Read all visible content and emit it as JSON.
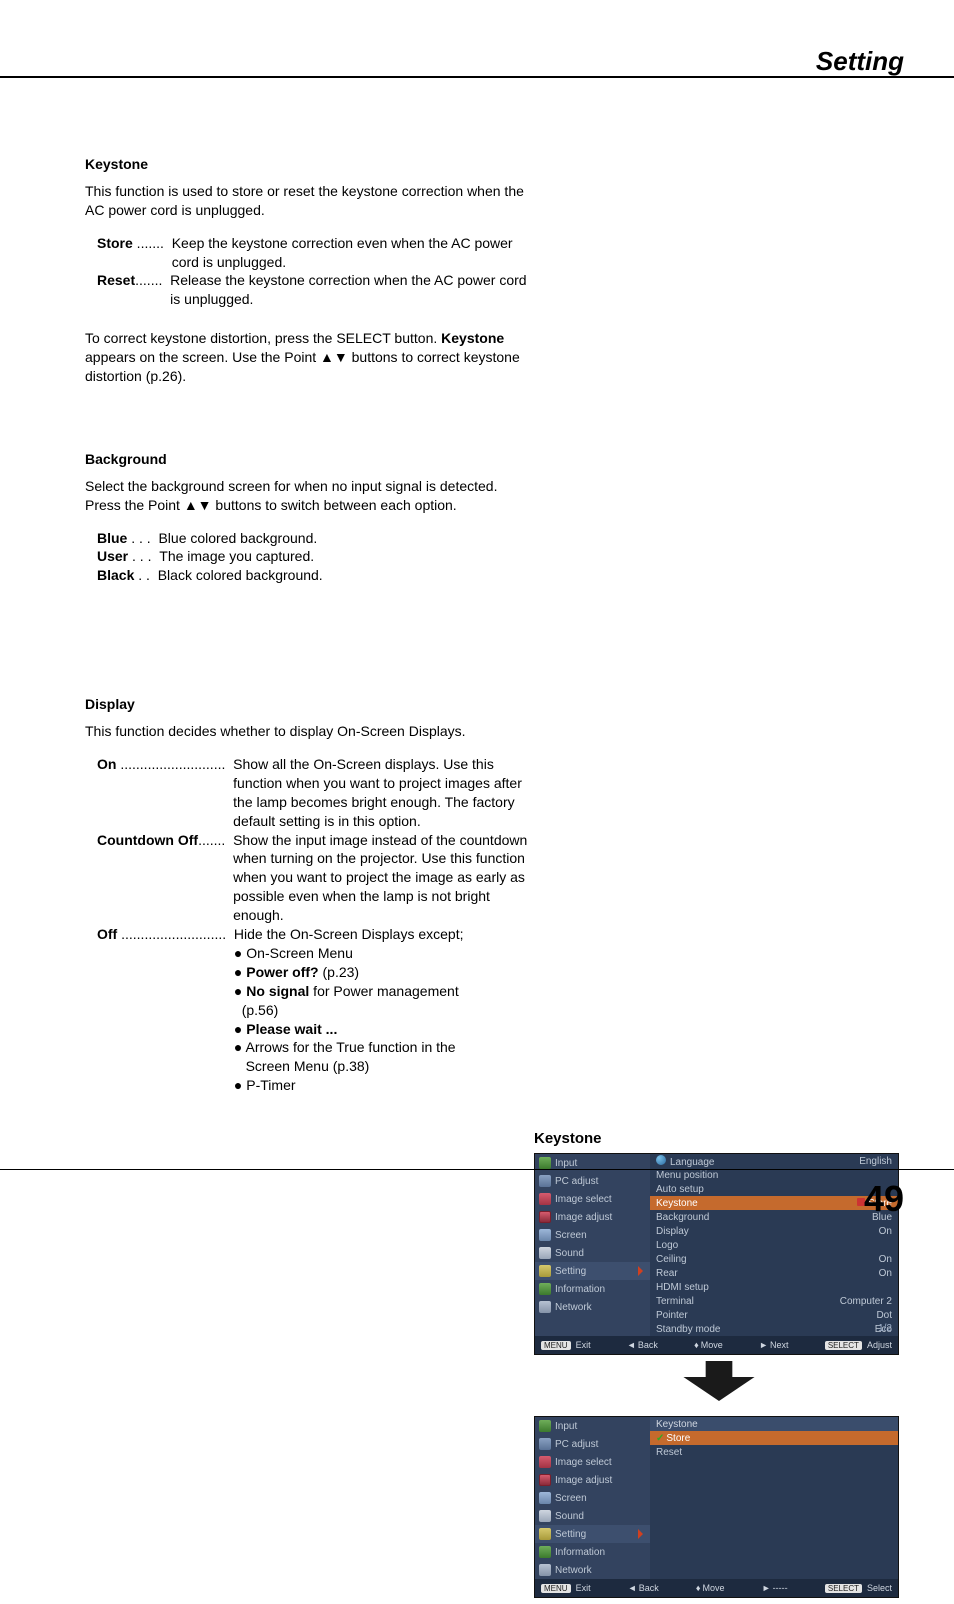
{
  "header": {
    "title": "Setting"
  },
  "page_number": "49",
  "sections": {
    "keystone": {
      "title": "Keystone",
      "intro": "This function is used to store or reset the keystone correction when the AC power cord is unplugged.",
      "items": [
        {
          "term": "Store",
          "dots": " .......  ",
          "desc": "Keep the keystone correction even when the AC power cord is unplugged."
        },
        {
          "term": "Reset",
          "dots": ".......  ",
          "desc": "Release the keystone correction when the AC power cord is unplugged."
        }
      ],
      "note_pre": "To correct keystone distortion, press the SELECT button. ",
      "note_bold": "Keystone",
      "note_mid": " appears on the screen. Use the Point ▲▼ buttons to correct keystone distortion (p.26)."
    },
    "background": {
      "title": "Background",
      "intro": "Select the background screen for when no input signal is detected. Press the Point ▲▼ buttons to switch between each option.",
      "items": [
        {
          "term": "Blue",
          "dots": " . . .  ",
          "desc": "Blue colored background."
        },
        {
          "term": "User",
          "dots": " . . .  ",
          "desc": "The image you captured."
        },
        {
          "term": "Black",
          "dots": " . .  ",
          "desc": "Black colored background."
        }
      ]
    },
    "display": {
      "title": "Display",
      "intro": "This function decides whether to display On-Screen Displays.",
      "items": {
        "on": {
          "term": "On",
          "dots": " ...........................  ",
          "desc": "Show all the On-Screen displays. Use this function when you want to project images after the lamp becomes bright enough. The factory default setting is in this option."
        },
        "cd": {
          "term": "Countdown Off",
          "dots": ".......  ",
          "desc": "Show the input image instead of the countdown when turning on the projector. Use this function when you want to project the image as early as possible even when the lamp is not bright enough."
        },
        "off": {
          "term": "Off",
          "dots": " ...........................  ",
          "lead": "Hide the On-Screen Displays except;",
          "bullets": {
            "b1": "● On-Screen Menu",
            "b2a": "● ",
            "b2b": "Power off?",
            "b2c": " (p.23)",
            "b3a": "● ",
            "b3b": "No signal",
            "b3c": " for Power management",
            "b3d": "  (p.56)",
            "b4a": "● ",
            "b4b": "Please wait ...",
            "b5": "● Arrows for the True function in the",
            "b5b": "   Screen Menu (p.38)",
            "b6": "● P-Timer"
          }
        }
      }
    }
  },
  "osd": {
    "label": "Keystone",
    "sidebar": [
      {
        "icon": "ic-input",
        "label": "Input"
      },
      {
        "icon": "ic-pc",
        "label": "PC adjust"
      },
      {
        "icon": "ic-imgsel",
        "label": "Image select"
      },
      {
        "icon": "ic-imgadj",
        "label": "Image adjust"
      },
      {
        "icon": "ic-screen",
        "label": "Screen"
      },
      {
        "icon": "ic-sound",
        "label": "Sound"
      },
      {
        "icon": "ic-setting",
        "label": "Setting"
      },
      {
        "icon": "ic-info",
        "label": "Information"
      },
      {
        "icon": "ic-network",
        "label": "Network"
      }
    ],
    "panel1": {
      "rows": [
        {
          "l": "Language",
          "r": "English",
          "globe": true
        },
        {
          "l": "Menu position",
          "r": ""
        },
        {
          "l": "Auto setup",
          "r": ""
        },
        {
          "l": "Keystone",
          "r": "Store",
          "hl": true,
          "storeic": true
        },
        {
          "l": "Background",
          "r": "Blue"
        },
        {
          "l": "Display",
          "r": "On"
        },
        {
          "l": "Logo",
          "r": ""
        },
        {
          "l": "Ceiling",
          "r": "On"
        },
        {
          "l": "Rear",
          "r": "On"
        },
        {
          "l": "HDMI setup",
          "r": ""
        },
        {
          "l": "Terminal",
          "r": "Computer 2"
        },
        {
          "l": "Pointer",
          "r": "Dot"
        },
        {
          "l": "Standby mode",
          "r": "Eco"
        }
      ],
      "page": "1/2",
      "footer": {
        "f1": "Exit",
        "f2": "Back",
        "f3": "Move",
        "f4": "Next",
        "f5": "Adjust",
        "b1": "MENU",
        "b5": "SELECT",
        "arr2": "◄",
        "arr3": "♦",
        "arr4": "►"
      }
    },
    "panel2": {
      "header": "Keystone",
      "rows": [
        {
          "l": "Store",
          "hl": true,
          "check": true
        },
        {
          "l": "Reset"
        }
      ],
      "footer": {
        "f1": "Exit",
        "f2": "Back",
        "f3": "Move",
        "f4": "-----",
        "f5": "Select",
        "b1": "MENU",
        "b5": "SELECT",
        "arr2": "◄",
        "arr3": "♦",
        "arr4": "►"
      }
    }
  }
}
